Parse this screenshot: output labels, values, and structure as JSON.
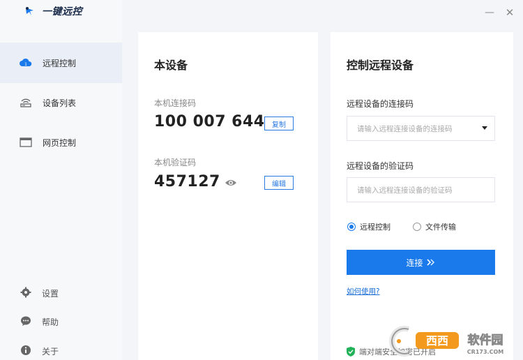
{
  "app": {
    "name": "一键远控"
  },
  "window": {
    "minimize": "—",
    "close": "✕"
  },
  "sidebar": {
    "items": [
      {
        "label": "远程控制",
        "icon": "cloud-remote-icon",
        "active": true
      },
      {
        "label": "设备列表",
        "icon": "device-list-icon",
        "active": false
      },
      {
        "label": "网页控制",
        "icon": "web-page-icon",
        "active": false
      }
    ],
    "footer": [
      {
        "label": "设置",
        "icon": "gear-icon"
      },
      {
        "label": "帮助",
        "icon": "help-chat-icon"
      },
      {
        "label": "关于",
        "icon": "info-icon"
      }
    ]
  },
  "local": {
    "title": "本设备",
    "code_label": "本机连接码",
    "code": "100 007 644",
    "copy_label": "复制",
    "verify_label": "本机验证码",
    "verify": "457127",
    "edit_label": "编辑"
  },
  "remote": {
    "title": "控制远程设备",
    "code_label": "远程设备的连接码",
    "code_placeholder": "请输入远程连接设备的连接码",
    "verify_label": "远程设备的验证码",
    "verify_placeholder": "请输入远程连接设备的验证码",
    "modes": [
      {
        "label": "远程控制",
        "selected": true
      },
      {
        "label": "文件传输",
        "selected": false
      }
    ],
    "connect_label": "连接",
    "help_link": "如何使用?",
    "security_text": "端对端安全加密已开启"
  },
  "watermark": {
    "brand": "西西软件园",
    "site": "CR173.COM"
  },
  "colors": {
    "accent": "#1a7aeb",
    "sidebar_active": "#e9eef7"
  }
}
